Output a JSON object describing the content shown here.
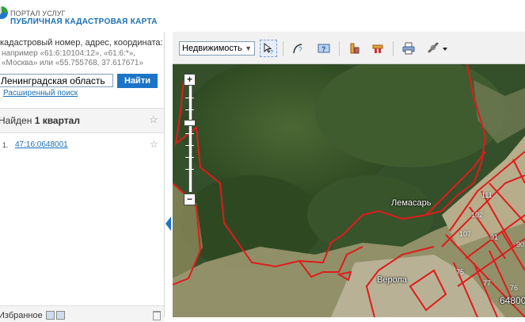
{
  "header": {
    "portal": "ПОРТАЛ УСЛУГ",
    "title": "ПУБЛИЧНАЯ КАДАСТРОВАЯ КАРТА"
  },
  "search": {
    "hint": "кадастровый номер, адрес, координата:",
    "example_line1": "например «61:6:10104:12», «61:6:*»,",
    "example_line2": "«Москва» или «55.755768, 37.617671»",
    "value": "Ленинградская область",
    "button": "Найти",
    "advanced": "Расширенный поиск"
  },
  "results": {
    "prefix": "Найден",
    "count": "1 квартал",
    "items": [
      {
        "num": "1.",
        "cadastral": "47:16:0648001"
      }
    ]
  },
  "favorites": {
    "label": "Избранное"
  },
  "toolbar": {
    "layer_select": "Недвижимость",
    "tools": [
      "identify-icon",
      "measure-icon",
      "help-map-icon",
      "building-icon",
      "land-plot-icon",
      "print-icon",
      "link-icon"
    ]
  },
  "map": {
    "labels": {
      "village1": "Лемасарь",
      "village2": "Верола",
      "quarter": "64800"
    },
    "plots": [
      "111",
      "102",
      "107",
      "91",
      "75",
      "77",
      "76",
      "90"
    ]
  },
  "colors": {
    "accent": "#1d74c6",
    "boundary": "#e01b1b"
  }
}
